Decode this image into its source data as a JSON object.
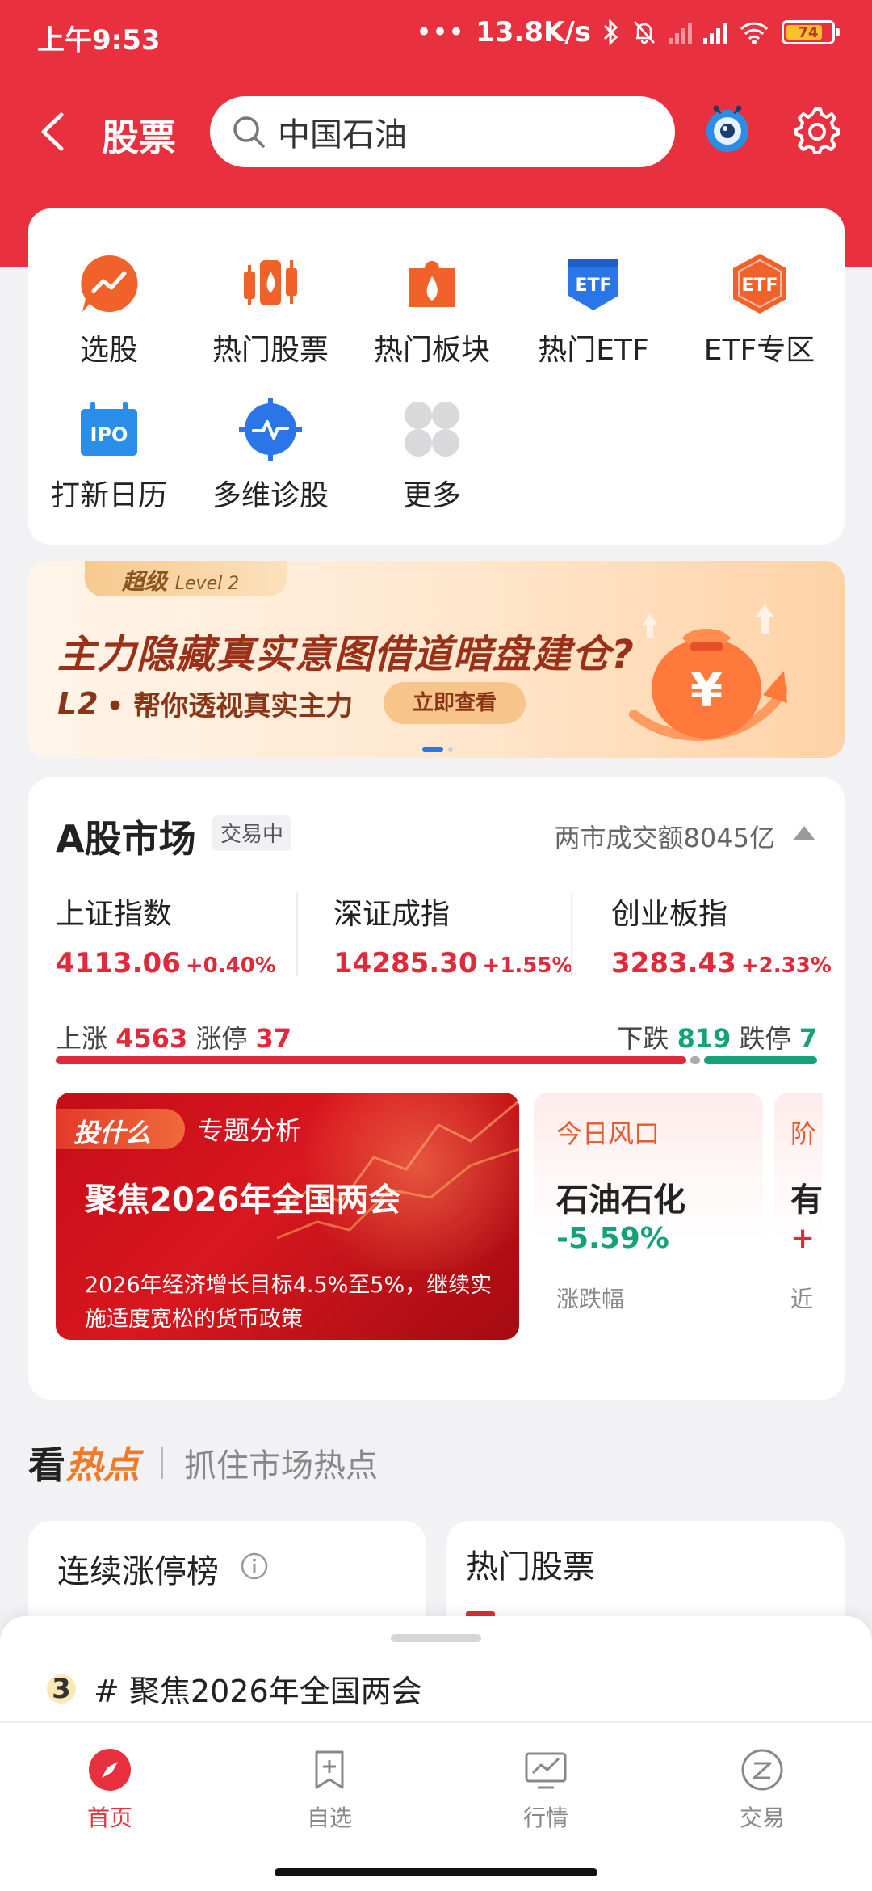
{
  "status_bar": {
    "time": "上午9:53",
    "net_speed": "13.8K/s",
    "battery": "74",
    "dots": "•••"
  },
  "header": {
    "title": "股票",
    "search_value": "中国石油"
  },
  "quick_menu": [
    {
      "label": "选股",
      "icon": "trend-bubble-icon"
    },
    {
      "label": "热门股票",
      "icon": "fire-candlestick-icon"
    },
    {
      "label": "热门板块",
      "icon": "fire-puzzle-icon"
    },
    {
      "label": "热门ETF",
      "icon": "etf-shield-icon"
    },
    {
      "label": "ETF专区",
      "icon": "etf-hexagon-icon"
    },
    {
      "label": "打新日历",
      "icon": "ipo-calendar-icon"
    },
    {
      "label": "多维诊股",
      "icon": "pulse-target-icon"
    },
    {
      "label": "更多",
      "icon": "more-grid-icon"
    }
  ],
  "banner": {
    "tag": "超级",
    "tag_level": "Level 2",
    "headline": "主力隐藏真实意图借道暗盘建仓?",
    "sub_prefix": "L2",
    "sub": "• 帮你透视真实主力",
    "cta": "立即查看"
  },
  "market": {
    "title": "A股市场",
    "status": "交易中",
    "volume": "两市成交额8045亿",
    "indices": [
      {
        "name": "上证指数",
        "value": "4113.06",
        "change": "+0.40%"
      },
      {
        "name": "深证成指",
        "value": "14285.30",
        "change": "+1.55%"
      },
      {
        "name": "创业板指",
        "value": "3283.43",
        "change": "+2.33%"
      }
    ],
    "breadth": {
      "up_label": "上涨",
      "up": "4563",
      "limit_up_label": "涨停",
      "limit_up": "37",
      "down_label": "下跌",
      "down": "819",
      "limit_down_label": "跌停",
      "limit_down": "7"
    },
    "breadth_colors": {
      "up": "#e02a3a",
      "flat": "#aaaaaa",
      "down": "#13a27a"
    },
    "topic": {
      "tag": "投什么",
      "section": "专题分析",
      "title": "聚焦2026年全国两会",
      "desc": "2026年经济增长目标4.5%至5%，继续实施适度宽松的货币政策"
    },
    "wind": {
      "tag": "今日风口",
      "name": "石油石化",
      "change": "-5.59%",
      "label": "涨跌幅"
    },
    "wind2": {
      "tag": "阶",
      "name": "有",
      "change": "+",
      "label": "近"
    }
  },
  "hot_section": {
    "title_a": "看",
    "title_b": "热点",
    "subtitle": "抓住市场热点"
  },
  "mini_cards": {
    "left_title": "连续涨停榜",
    "right_title": "热门股票"
  },
  "bottom_sheet": {
    "rank": "3",
    "text": "# 聚焦2026年全国两会"
  },
  "tabbar": [
    {
      "label": "首页",
      "icon": "compass-icon"
    },
    {
      "label": "自选",
      "icon": "add-bookmark-icon"
    },
    {
      "label": "行情",
      "icon": "monitor-chart-icon"
    },
    {
      "label": "交易",
      "icon": "trade-z-icon"
    }
  ],
  "colors": {
    "brand_red": "#e8303f",
    "rise": "#e02a3a",
    "fall": "#13a27a",
    "accent_orange": "#f06a2a"
  }
}
